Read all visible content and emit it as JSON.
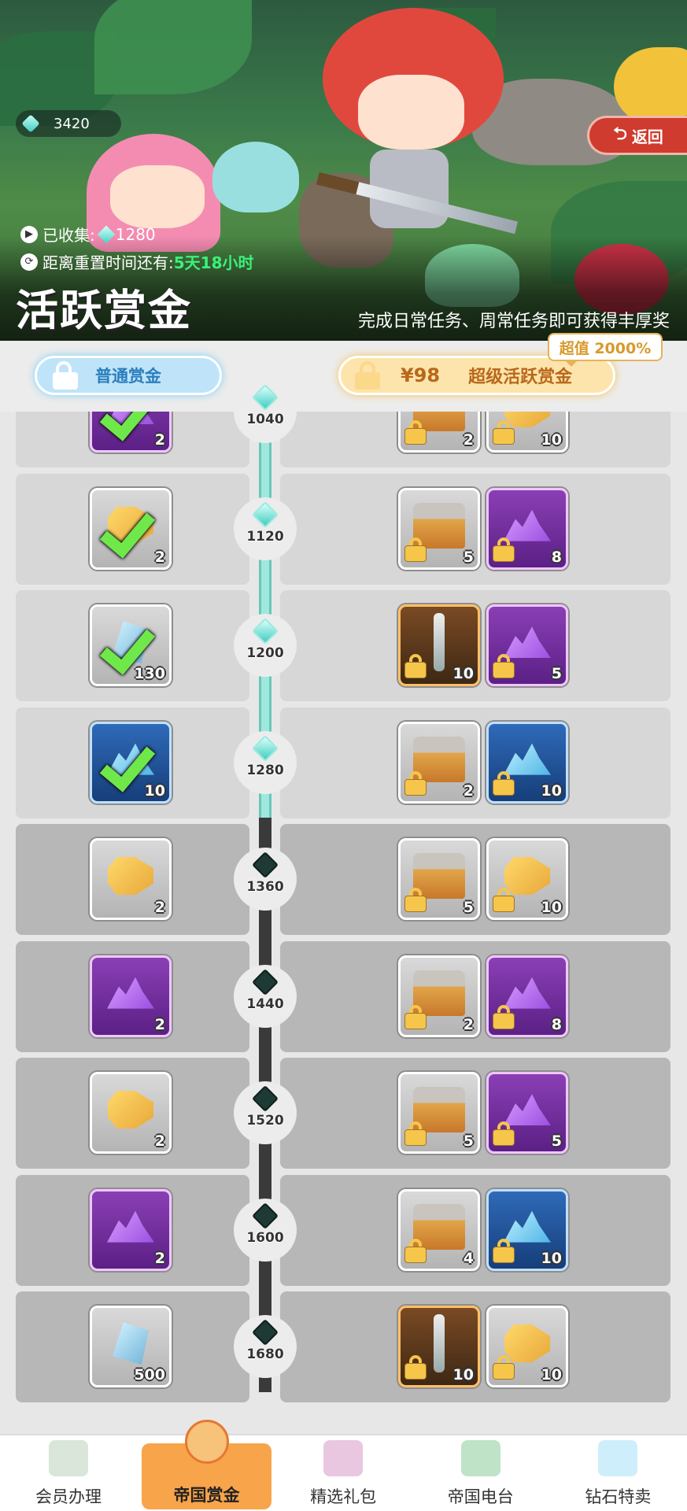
{
  "wallet": {
    "gems": "3420"
  },
  "back_label": "返回",
  "collected": {
    "label": "已收集:",
    "value": "1280"
  },
  "reset": {
    "label": "距离重置时间还有:",
    "value": "5天18小时"
  },
  "title": "活跃赏金",
  "subtitle": "完成日常任务、周常任务即可获得丰厚奖",
  "tabs": {
    "free": "普通赏金",
    "paid_price": "¥98",
    "paid_label": "超级活跃赏金",
    "value_badge": "超值 2000%"
  },
  "tiers": [
    {
      "level": "1040",
      "reached": true,
      "free": {
        "kind": "purple",
        "pic": "crystal",
        "qty": "2",
        "claimed": true
      },
      "paid": [
        {
          "kind": "gray",
          "pic": "chest",
          "qty": "2"
        },
        {
          "kind": "gray",
          "pic": "cheese",
          "qty": "10"
        }
      ]
    },
    {
      "level": "1120",
      "reached": true,
      "free": {
        "kind": "gray",
        "pic": "cheese",
        "qty": "2",
        "claimed": true
      },
      "paid": [
        {
          "kind": "gray",
          "pic": "chest",
          "qty": "5"
        },
        {
          "kind": "purple",
          "pic": "crystal",
          "qty": "8"
        }
      ]
    },
    {
      "level": "1200",
      "reached": true,
      "free": {
        "kind": "gray",
        "pic": "gem",
        "qty": "130",
        "claimed": true
      },
      "paid": [
        {
          "kind": "orange",
          "pic": "sword",
          "qty": "10"
        },
        {
          "kind": "purple",
          "pic": "crystal",
          "qty": "5"
        }
      ]
    },
    {
      "level": "1280",
      "reached": true,
      "free": {
        "kind": "blue",
        "pic": "crystal-b",
        "qty": "10",
        "claimed": true
      },
      "paid": [
        {
          "kind": "gray",
          "pic": "chest",
          "qty": "2"
        },
        {
          "kind": "blue",
          "pic": "crystal-b",
          "qty": "10"
        }
      ]
    },
    {
      "level": "1360",
      "reached": false,
      "free": {
        "kind": "gray",
        "pic": "cheese",
        "qty": "2",
        "claimed": false
      },
      "paid": [
        {
          "kind": "gray",
          "pic": "chest",
          "qty": "5"
        },
        {
          "kind": "gray",
          "pic": "cheese",
          "qty": "10"
        }
      ]
    },
    {
      "level": "1440",
      "reached": false,
      "free": {
        "kind": "purple",
        "pic": "crystal",
        "qty": "2",
        "claimed": false
      },
      "paid": [
        {
          "kind": "gray",
          "pic": "chest",
          "qty": "2"
        },
        {
          "kind": "purple",
          "pic": "crystal",
          "qty": "8"
        }
      ]
    },
    {
      "level": "1520",
      "reached": false,
      "free": {
        "kind": "gray",
        "pic": "cheese",
        "qty": "2",
        "claimed": false
      },
      "paid": [
        {
          "kind": "gray",
          "pic": "chest",
          "qty": "5"
        },
        {
          "kind": "purple",
          "pic": "crystal",
          "qty": "5"
        }
      ]
    },
    {
      "level": "1600",
      "reached": false,
      "free": {
        "kind": "purple",
        "pic": "crystal",
        "qty": "2",
        "claimed": false
      },
      "paid": [
        {
          "kind": "gray",
          "pic": "chest",
          "qty": "4"
        },
        {
          "kind": "blue",
          "pic": "crystal-b",
          "qty": "10"
        }
      ]
    },
    {
      "level": "1680",
      "reached": false,
      "free": {
        "kind": "gray",
        "pic": "gem",
        "qty": "500",
        "claimed": false
      },
      "paid": [
        {
          "kind": "orange",
          "pic": "sword",
          "qty": "10"
        },
        {
          "kind": "gray",
          "pic": "cheese",
          "qty": "10"
        }
      ]
    }
  ],
  "nav": [
    {
      "label": "会员办理",
      "icon": "membership-card-icon",
      "color": "#d9e6d9"
    },
    {
      "label": "帝国赏金",
      "icon": "bounty-emblem-icon",
      "color": "#f8a44a",
      "active": true
    },
    {
      "label": "精选礼包",
      "icon": "gift-pack-icon",
      "color": "#e9c7e0"
    },
    {
      "label": "帝国电台",
      "icon": "radio-scroll-icon",
      "color": "#bfe3c7"
    },
    {
      "label": "钻石特卖",
      "icon": "diamond-chest-icon",
      "color": "#cfeefc"
    }
  ],
  "colors": {
    "accent_free": "#bfe4fa",
    "accent_paid": "#fde4ac",
    "back_red": "#cf3b2e",
    "timer_green": "#3bf07a"
  }
}
